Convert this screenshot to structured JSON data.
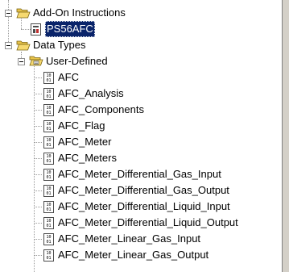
{
  "tree": {
    "add_on_instructions": {
      "label": "Add-On Instructions",
      "icon": "folder-open-icon",
      "children": [
        {
          "label": "PS56AFC",
          "icon": "add-on-instruction-icon",
          "selected": true
        }
      ]
    },
    "data_types": {
      "label": "Data Types",
      "icon": "folder-open-icon",
      "user_defined": {
        "label": "User-Defined",
        "icon": "user-defined-folder-icon",
        "items": [
          "AFC",
          "AFC_Analysis",
          "AFC_Components",
          "AFC_Flag",
          "AFC_Meter",
          "AFC_Meters",
          "AFC_Meter_Differential_Gas_Input",
          "AFC_Meter_Differential_Gas_Output",
          "AFC_Meter_Differential_Liquid_Input",
          "AFC_Meter_Differential_Liquid_Output",
          "AFC_Meter_Linear_Gas_Input",
          "AFC_Meter_Linear_Gas_Output"
        ],
        "item_icon": "data-type-icon"
      }
    }
  },
  "colors": {
    "selection_bg": "#0a246a",
    "selection_text": "#ffffff",
    "folder_fill": "#f6d96f",
    "tree_line": "#9a9a9a"
  }
}
